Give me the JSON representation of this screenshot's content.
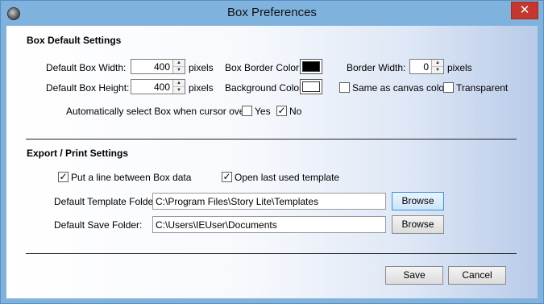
{
  "window": {
    "title": "Box Preferences",
    "close_label": "✕"
  },
  "box_settings": {
    "heading": "Box Default Settings",
    "width_label": "Default Box Width:",
    "width_value": "400",
    "height_label": "Default Box Height:",
    "height_value": "400",
    "unit": "pixels",
    "border_color_label": "Box Border Color:",
    "border_color": "#000000",
    "background_color_label": "Background Color:",
    "background_color": "#ffffff",
    "border_width_label": "Border Width:",
    "border_width_value": "0",
    "same_as_canvas_label": "Same as canvas color",
    "same_as_canvas_checked": false,
    "transparent_label": "Transparent",
    "transparent_checked": false,
    "auto_select_label": "Automatically select Box when cursor over:",
    "yes_label": "Yes",
    "yes_checked": false,
    "no_label": "No",
    "no_checked": true
  },
  "export_settings": {
    "heading": "Export / Print Settings",
    "line_between_label": "Put a line between Box data",
    "line_between_checked": true,
    "open_last_label": "Open last used template",
    "open_last_checked": true,
    "template_folder_label": "Default Template Folder:",
    "template_folder_value": "C:\\Program Files\\Story Lite\\Templates",
    "save_folder_label": "Default Save Folder:",
    "save_folder_value": "C:\\Users\\IEUser\\Documents",
    "browse_label": "Browse"
  },
  "footer": {
    "save_label": "Save",
    "cancel_label": "Cancel"
  },
  "icons": {
    "app": "app-orb-icon",
    "close": "close-icon",
    "spin_up": "spin-up-icon",
    "spin_down": "spin-down-icon",
    "check": "checkmark-icon"
  }
}
